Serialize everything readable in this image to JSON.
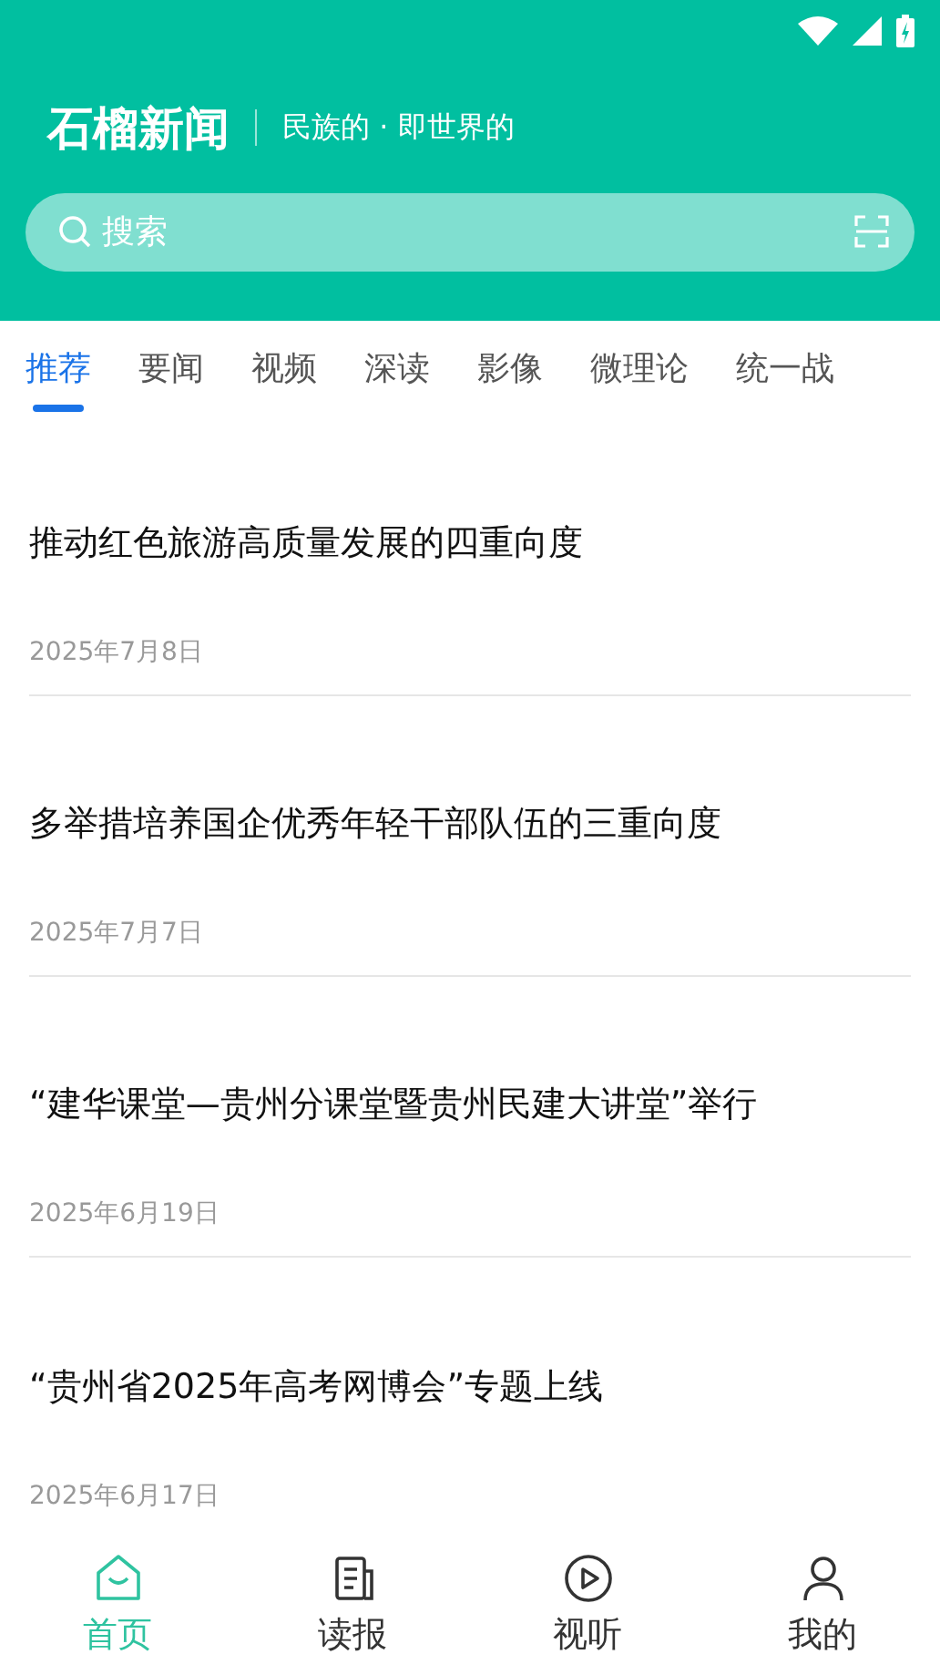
{
  "header": {
    "logo": "石榴新闻",
    "slogan": "民族的 · 即世界的"
  },
  "search": {
    "placeholder": "搜索"
  },
  "tabs": [
    {
      "label": "推荐",
      "selected": true
    },
    {
      "label": "要闻",
      "selected": false
    },
    {
      "label": "视频",
      "selected": false
    },
    {
      "label": "深读",
      "selected": false
    },
    {
      "label": "影像",
      "selected": false
    },
    {
      "label": "微理论",
      "selected": false
    },
    {
      "label": "统一战",
      "selected": false
    }
  ],
  "articles": [
    {
      "title": "推动红色旅游高质量发展的四重向度",
      "date": "2025年7月8日"
    },
    {
      "title": "多举措培养国企优秀年轻干部队伍的三重向度",
      "date": "2025年7月7日"
    },
    {
      "title": "“建华课堂—贵州分课堂暨贵州民建大讲堂”举行",
      "date": "2025年6月19日"
    },
    {
      "title": "“贵州省2025年高考网博会”专题上线",
      "date": "2025年6月17日"
    }
  ],
  "bottom_nav": [
    {
      "label": "首页",
      "kind": "home",
      "selected": true
    },
    {
      "label": "读报",
      "kind": "paper",
      "selected": false
    },
    {
      "label": "视听",
      "kind": "play",
      "selected": false
    },
    {
      "label": "我的",
      "kind": "user",
      "selected": false
    }
  ]
}
